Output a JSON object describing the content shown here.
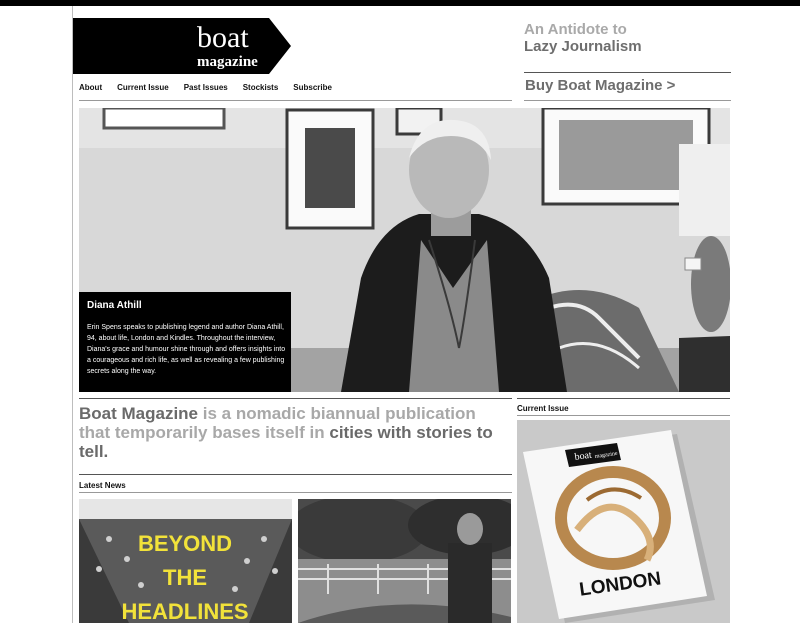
{
  "logo": {
    "word1": "boat",
    "word2": "magazine"
  },
  "tagline": {
    "line1": "An Antidote to",
    "line2": "Lazy Journalism"
  },
  "nav": {
    "items": [
      {
        "label": "About"
      },
      {
        "label": "Current Issue"
      },
      {
        "label": "Past Issues"
      },
      {
        "label": "Stockists"
      },
      {
        "label": "Subscribe"
      }
    ]
  },
  "buy_link": "Buy Boat Magazine >",
  "hero": {
    "title": "Diana Athill",
    "body": "Erin Spens speaks to publishing legend and author Diana Athill, 94, about life, London and Kindles. Throughout the interview, Diana's grace and humour shine through and offers insights into a courageous and rich life, as well as revealing a few publishing secrets along the way."
  },
  "intro": {
    "brand": "Boat Magazine",
    "middle": " is a nomadic biannual publication that temporarily bases itself in ",
    "end": "cities with stories to tell."
  },
  "latest_news_label": "Latest News",
  "current_issue_label": "Current Issue",
  "news": [
    {
      "headline": "BEYOND THE HEADLINES"
    }
  ],
  "cover": {
    "logo_word1": "boat",
    "logo_word2": "magazine",
    "city": "LONDON"
  },
  "colors": {
    "brand_black": "#000000",
    "headline_yellow": "#f2e23a",
    "muted_grey": "#a8a8a8",
    "dark_grey": "#6a6a6a"
  }
}
